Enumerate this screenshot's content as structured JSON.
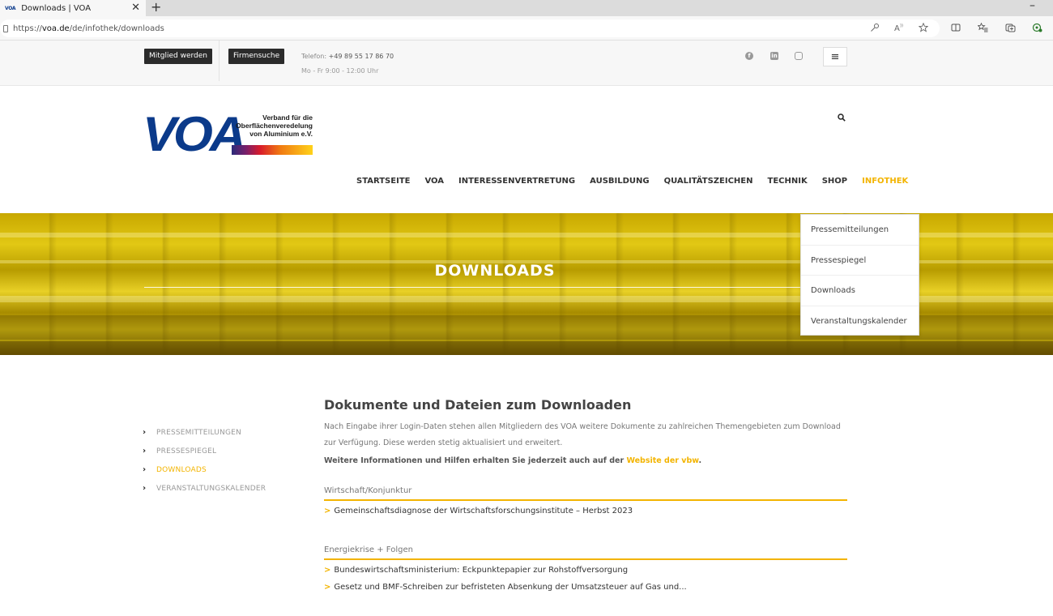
{
  "browser": {
    "tab_title": "Downloads | VOA",
    "tab_favicon": "VOA",
    "tab_close": "✕",
    "new_tab": "+",
    "minimize": "–",
    "url_prefix": "https://",
    "url_host": "voa.de",
    "url_path": "/de/infothek/downloads"
  },
  "topbar": {
    "member_button": "Mitglied werden",
    "company_search_button": "Firmensuche",
    "phone_label": "Telefon: ",
    "phone_number": "+49 89 55 17 86 70",
    "hours": "Mo - Fr 9:00 - 12:00 Uhr",
    "social_icons": [
      "facebook-icon",
      "linkedin-icon",
      "instagram-icon"
    ]
  },
  "logo": {
    "mark": "VOA",
    "line1": "Verband für die",
    "line2": "Oberflächenveredelung",
    "line3": "von Aluminium e.V."
  },
  "nav": {
    "items": [
      "STARTSEITE",
      "VOA",
      "INTERESSENVERTRETUNG",
      "AUSBILDUNG",
      "QUALITÄTSZEICHEN",
      "TECHNIK",
      "SHOP",
      "INFOTHEK"
    ],
    "active": "INFOTHEK",
    "accent_color": "#f3b400"
  },
  "hero": {
    "title": "DOWNLOADS"
  },
  "dropdown": {
    "items": [
      "Pressemitteilungen",
      "Pressespiegel",
      "Downloads",
      "Veranstaltungskalender"
    ]
  },
  "sidebar": {
    "items": [
      "PRESSEMITTEILUNGEN",
      "PRESSESPIEGEL",
      "DOWNLOADS",
      "VERANSTALTUNGSKALENDER"
    ],
    "active": "DOWNLOADS"
  },
  "content": {
    "title": "Dokumente und Dateien zum Downloaden",
    "paragraph": "Nach Eingabe ihrer Login-Daten stehen allen Mitgliedern des VOA weitere Dokumente zu zahlreichen Themengebieten zum Download zur Verfügung. Diese werden stetig aktualisiert und erweitert.",
    "info_text": "Weitere Informationen und Hilfen erhalten Sie jederzeit auch auf der ",
    "info_link": "Website der vbw",
    "info_end": ".",
    "sections": [
      {
        "heading": "Wirtschaft/Konjunktur",
        "items": [
          "Gemeinschaftsdiagnose der Wirtschaftsforschungsinstitute – Herbst 2023"
        ]
      },
      {
        "heading": "Energiekrise + Folgen",
        "items": [
          "Bundeswirtschaftsministerium: Eckpunktepapier zur Rohstoffversorgung",
          "Gesetz und BMF-Schreiben zur befristeten Absenkung der Umsatzsteuer auf Gas und..."
        ]
      }
    ]
  }
}
